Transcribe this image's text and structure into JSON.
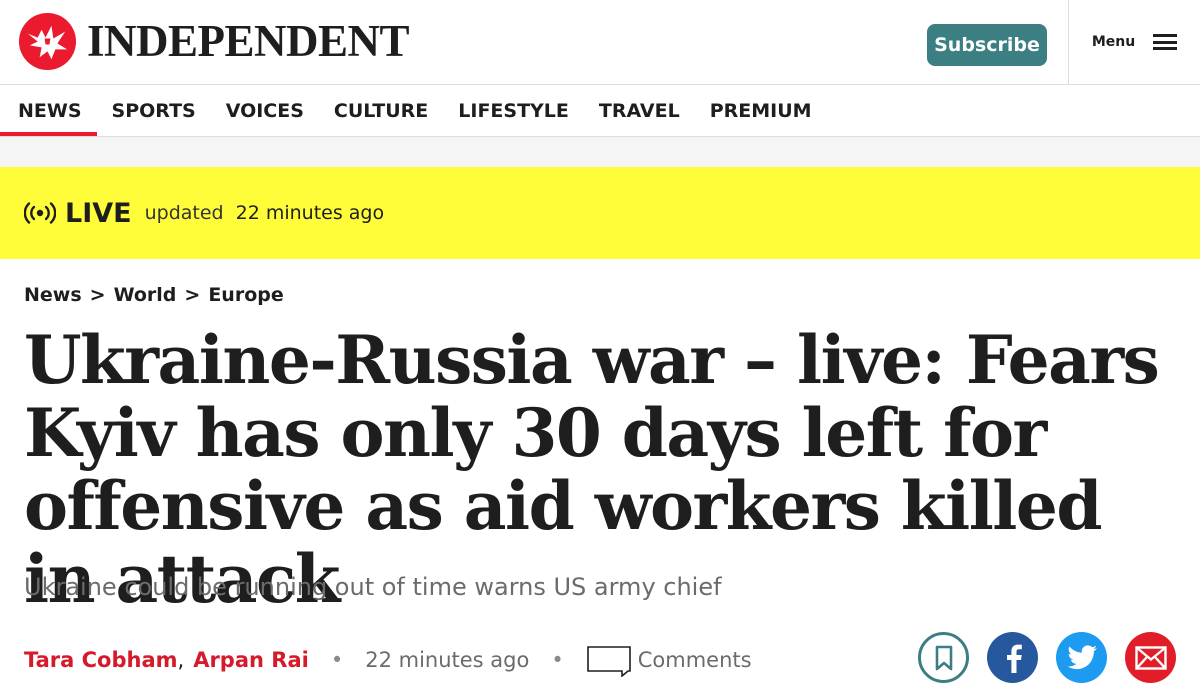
{
  "header": {
    "logo_text": "INDEPENDENT",
    "subscribe_label": "Subscribe",
    "menu_label": "Menu"
  },
  "nav": {
    "items": [
      {
        "label": "NEWS",
        "active": true
      },
      {
        "label": "SPORTS"
      },
      {
        "label": "VOICES"
      },
      {
        "label": "CULTURE"
      },
      {
        "label": "LIFESTYLE"
      },
      {
        "label": "TRAVEL"
      },
      {
        "label": "PREMIUM"
      }
    ]
  },
  "live": {
    "label": "LIVE",
    "updated_text": "updated",
    "time": "22 minutes ago",
    "icon": "broadcast-icon"
  },
  "breadcrumb": {
    "items": [
      "News",
      "World",
      "Europe"
    ],
    "separator": ">"
  },
  "article": {
    "headline": "Ukraine-Russia war – live: Fears Kyiv has only 30 days left for offensive as aid workers killed in attack",
    "standfirst": "Ukraine could be running out of time warns US army chief",
    "authors": [
      "Tara Cobham",
      "Arpan Rai"
    ],
    "author_separator": ",",
    "meta_dot": "•",
    "time": "22 minutes ago",
    "comments_label": "Comments"
  },
  "share": {
    "icons": [
      "bookmark-icon",
      "facebook-icon",
      "twitter-icon",
      "email-icon"
    ]
  },
  "colors": {
    "accent_red": "#ec1a2e",
    "author_red": "#d51a2b",
    "subscribe_teal": "#3b7f82",
    "live_yellow": "#fffc3a",
    "facebook_blue": "#26589e",
    "twitter_blue": "#1d9bf0",
    "email_red": "#e11d2a"
  }
}
